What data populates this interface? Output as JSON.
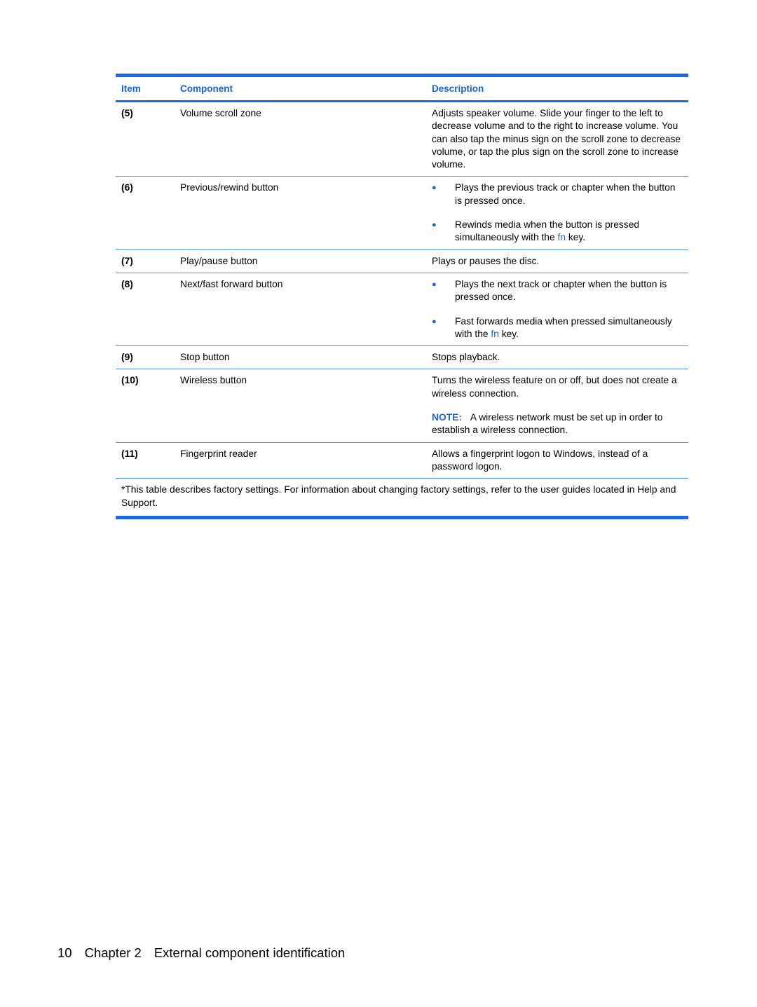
{
  "table": {
    "headers": {
      "item": "Item",
      "component": "Component",
      "description": "Description"
    },
    "rows": [
      {
        "item": "(5)",
        "component": "Volume scroll zone",
        "description": "Adjusts speaker volume. Slide your finger to the left to decrease volume and to the right to increase volume. You can also tap the minus sign on the scroll zone to decrease volume, or tap the plus sign on the scroll zone to increase volume."
      },
      {
        "item": "(6)",
        "component": "Previous/rewind button",
        "bullets": [
          {
            "text": "Plays the previous track or chapter when the button is pressed once."
          },
          {
            "pre": "Rewinds media when the button is pressed simultaneously with the ",
            "key": "fn",
            "post": " key."
          }
        ]
      },
      {
        "item": "(7)",
        "component": "Play/pause button",
        "description": "Plays or pauses the disc."
      },
      {
        "item": "(8)",
        "component": "Next/fast forward button",
        "bullets": [
          {
            "text": "Plays the next track or chapter when the button is pressed once."
          },
          {
            "pre": "Fast forwards media when pressed simultaneously with the ",
            "key": "fn",
            "post": " key."
          }
        ]
      },
      {
        "item": "(9)",
        "component": "Stop button",
        "description": "Stops playback."
      },
      {
        "item": "(10)",
        "component": "Wireless button",
        "description": "Turns the wireless feature on or off, but does not create a wireless connection.",
        "note_label": "NOTE:",
        "note_text": "A wireless network must be set up in order to establish a wireless connection."
      },
      {
        "item": "(11)",
        "component": "Fingerprint reader",
        "description": "Allows a fingerprint logon to Windows, instead of a password logon."
      }
    ],
    "footnote": "*This table describes factory settings. For information about changing factory settings, refer to the user guides located in Help and Support."
  },
  "footer": {
    "page_number": "10",
    "chapter": "Chapter 2",
    "chapter_title": "External component identification"
  },
  "colors": {
    "accent": "#1a62e0"
  }
}
